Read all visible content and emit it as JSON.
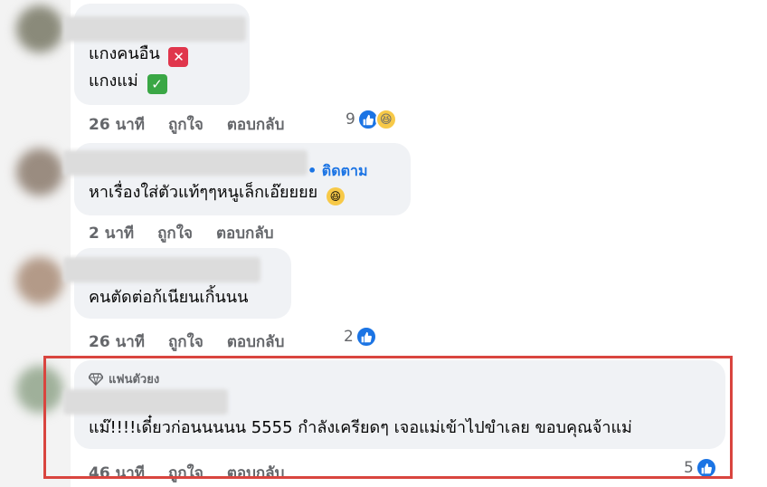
{
  "comments": [
    {
      "lines": [
        "แกงคนอืน",
        "แกงแม่"
      ],
      "time": "26 นาที",
      "like_label": "ถูกใจ",
      "reply_label": "ตอบกลับ",
      "reaction_count": "9"
    },
    {
      "follow_label": "• ติดตาม",
      "text": "หาเรื่องใส่ตัวแท้ๆๆหนูเล็กเอ๊ยยยย",
      "time": "2 นาที",
      "like_label": "ถูกใจ",
      "reply_label": "ตอบกลับ"
    },
    {
      "text": "คนตัดต่อก้เนียนเกิ้นนน",
      "time": "26 นาที",
      "like_label": "ถูกใจ",
      "reply_label": "ตอบกลับ",
      "reaction_count": "2"
    },
    {
      "badge": "แฟนตัวยง",
      "text": "แม๊!!!!เดี๋ยวก่อนนนนน 5555 กำลังเครียดๆ เจอแม่เข้าไปขำเลย ขอบคุณจ้าแม่",
      "time": "46 นาที",
      "like_label": "ถูกใจ",
      "reply_label": "ตอบกลับ",
      "reaction_count": "5"
    }
  ],
  "colors": {
    "like_blue": "#1b74e4",
    "meta_gray": "#65676b",
    "bubble_bg": "#f0f2f5",
    "highlight_red": "#d9453f"
  },
  "icons": [
    "cross-mark-icon",
    "check-mark-icon",
    "grinning-emoji-icon",
    "like-reaction-icon",
    "haha-reaction-icon",
    "diamond-icon"
  ]
}
